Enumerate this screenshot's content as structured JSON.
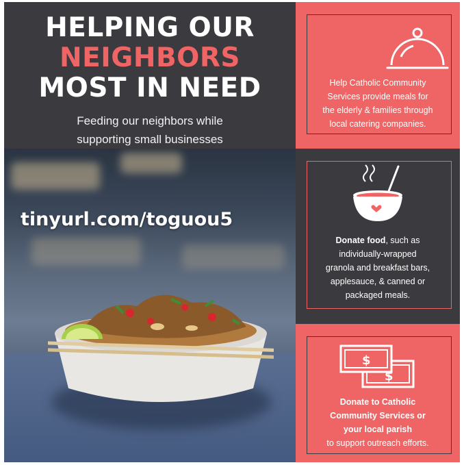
{
  "headline": {
    "line1": "HELPING OUR",
    "line2": "NEIGHBORS",
    "line3": "MOST IN NEED"
  },
  "subtitle": {
    "line1": "Feeding our neighbors while",
    "line2": "supporting small businesses"
  },
  "url": "tinyurl.com/toguou5",
  "panels": [
    {
      "icon": "cloche-icon",
      "lines": [
        "Help Catholic Community",
        "Services provide meals for",
        "the elderly & families through",
        "local catering companies."
      ]
    },
    {
      "icon": "soup-bowl-icon",
      "bold": "Donate food",
      "lines": [
        ", such as",
        "individually-wrapped",
        "granola and breakfast bars,",
        "applesauce, & canned or",
        "packaged meals."
      ]
    },
    {
      "icon": "money-icon",
      "bold_lines": [
        "Donate to Catholic",
        "Community Services or",
        "your local parish"
      ],
      "line": "to support outreach efforts."
    }
  ],
  "colors": {
    "coral": "#ef6464",
    "charcoal": "#3b3a3e"
  }
}
